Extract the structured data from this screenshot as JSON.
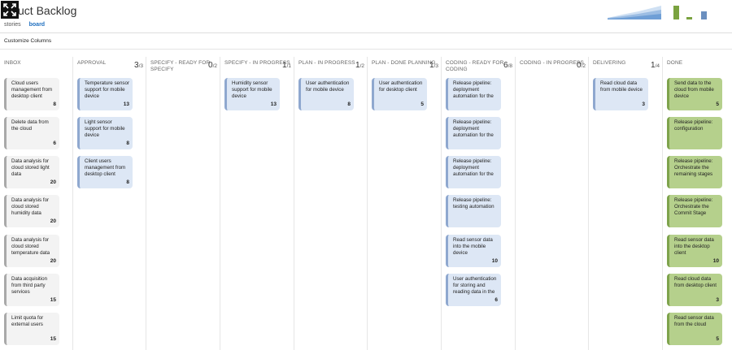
{
  "header": {
    "title": "uct Backlog"
  },
  "view_tabs": [
    {
      "label": "stories"
    },
    {
      "label": "board"
    }
  ],
  "toolbar": {
    "customize_columns": "Customize Columns"
  },
  "columns": [
    {
      "name": "INBOX",
      "count": "",
      "limit": "",
      "cards": [
        {
          "text": "Cloud users management from desktop client",
          "est": "8"
        },
        {
          "text": "Delete data from the cloud",
          "est": "6"
        },
        {
          "text": "Data analysis for cloud stored light data",
          "est": "20"
        },
        {
          "text": "Data analysis for cloud stored humidity data",
          "est": "20"
        },
        {
          "text": "Data analysis for cloud stored temperature data",
          "est": "20"
        },
        {
          "text": "Data acquisition from third party services",
          "est": "15"
        },
        {
          "text": "Limit quota for external users",
          "est": "15"
        }
      ]
    },
    {
      "name": "APPROVAL",
      "count": "3",
      "limit": "/3",
      "cards": [
        {
          "text": "Temperature sensor support for mobile device",
          "est": "13"
        },
        {
          "text": "Light sensor support for mobile device",
          "est": "8"
        },
        {
          "text": "Client users management from desktop client",
          "est": "8"
        }
      ]
    },
    {
      "name": "SPECIFY - READY FOR SPECIFY",
      "count": "0",
      "limit": "/2",
      "cards": []
    },
    {
      "name": "SPECIFY - IN PROGRESS",
      "count": "1",
      "limit": "/1",
      "cards": [
        {
          "text": "Humidity sensor support for mobile device",
          "est": "13"
        }
      ]
    },
    {
      "name": "PLAN - IN PROGRESS",
      "count": "1",
      "limit": "/2",
      "cards": [
        {
          "text": "User authentication for mobile device",
          "est": "8"
        }
      ]
    },
    {
      "name": "PLAN - DONE PLANNING",
      "count": "1",
      "limit": "/3",
      "cards": [
        {
          "text": "User authentication for desktop client",
          "est": "5"
        }
      ]
    },
    {
      "name": "CODING - READY FOR CODING",
      "count": "6",
      "limit": "/8",
      "cards": [
        {
          "text": "Release pipeline: deployment automation for the",
          "est": ""
        },
        {
          "text": "Release pipeline: deployment automation for the",
          "est": ""
        },
        {
          "text": "Release pipeline: deployment automation for the",
          "est": ""
        },
        {
          "text": "Release pipeline: testing automation",
          "est": ""
        },
        {
          "text": "Read sensor data into the mobile device",
          "est": "10"
        },
        {
          "text": "User authentication for storing and reading data in the",
          "est": "6"
        }
      ]
    },
    {
      "name": "CODING - IN PROGRESS",
      "count": "0",
      "limit": "/2",
      "cards": []
    },
    {
      "name": "DELIVERING",
      "count": "1",
      "limit": "/4",
      "cards": [
        {
          "text": "Read cloud data from mobile device",
          "est": "3"
        }
      ]
    },
    {
      "name": "DONE",
      "count": "",
      "limit": "",
      "cards": [
        {
          "text": "Send data to the cloud from mobile device",
          "est": "5"
        },
        {
          "text": "Release pipeline: configuration",
          "est": ""
        },
        {
          "text": "Release pipeline: Orchestrate the remaining stages",
          "est": ""
        },
        {
          "text": "Release pipeline: Orchestrate the Commit Stage",
          "est": ""
        },
        {
          "text": "Read sensor data into the desktop client",
          "est": "10"
        },
        {
          "text": "Read cloud data from desktop client",
          "est": "3"
        },
        {
          "text": "Read sensor data from the cloud",
          "est": "5"
        }
      ]
    }
  ],
  "colors": {
    "gray": "#f3f3f3",
    "blue": "#dde7f5",
    "green": "#b5d08c",
    "accent": "#1f6fbf"
  }
}
